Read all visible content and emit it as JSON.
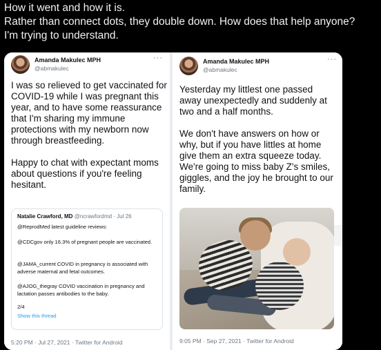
{
  "caption": {
    "line1": "How it went and how it is.",
    "line2": "Rather than connect dots, they double down. How does that help anyone?",
    "line3": "I'm trying to understand."
  },
  "tweet_left": {
    "name": "Amanda Makulec MPH",
    "handle": "@abmakulec",
    "more": "···",
    "body_p1": "I was so relieved to get vaccinated for COVID-19 while I was pregnant this year, and to have some reassurance that I'm sharing my immune protections with my newborn now through breastfeeding.",
    "body_p2": "Happy to chat with expectant moms about questions if you're feeling hesitant.",
    "quoted": {
      "name": "Natalie Crawford, MD",
      "handle_date": "@ncrawfordmd · Jul 26",
      "line1": "@ReprodMed latest guideline reviews:",
      "line2": "@CDCgov only 16.3% of pregnant people are vaccinated.",
      "line3": "@JAMA_current COVID in pregnancy is associated with adverse maternal and fetal outcomes.",
      "line4": "@AJOG_thegray COVID vaccination in pregnancy and lactation passes antibodies to the baby.",
      "line5": "2/4",
      "show_thread": "Show this thread"
    },
    "meta": "5:20 PM · Jul 27, 2021 · Twitter for Android"
  },
  "tweet_right": {
    "name": "Amanda Makulec MPH",
    "handle": "@abmakulec",
    "more": "···",
    "body_p1": "Yesterday my littlest one passed away unexpectedly and suddenly at two and a half months.",
    "body_p2": "We don't have answers on how or why, but if you have littles at home give them an extra squeeze today. We're going to miss baby Z's smiles, giggles, and the joy he brought to our family.",
    "meta": "9:05 PM · Sep 27, 2021 · Twitter for Android"
  }
}
